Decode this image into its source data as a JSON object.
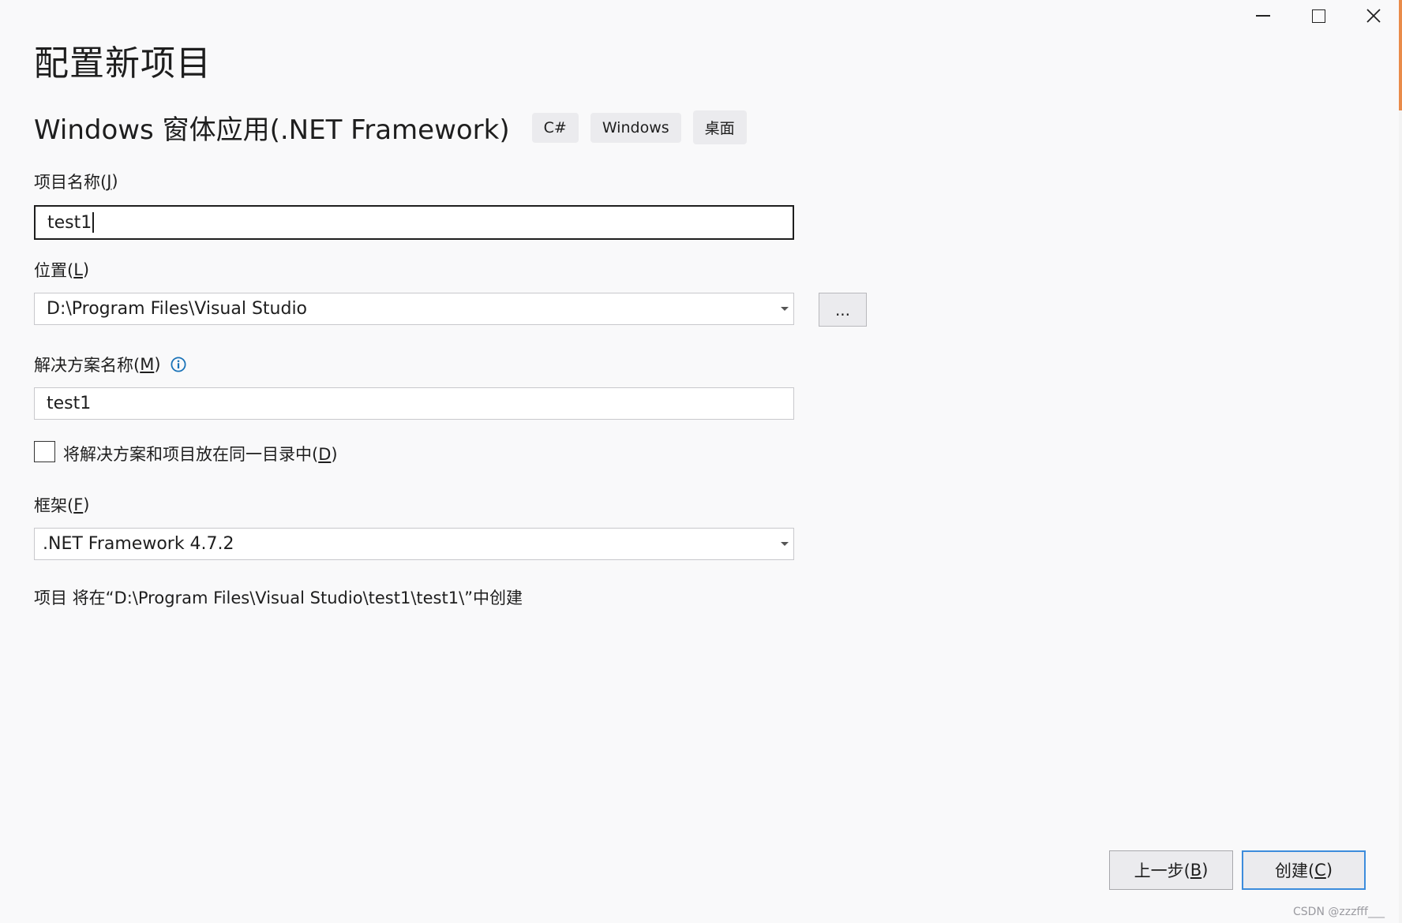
{
  "window": {
    "controls": [
      "minimize-icon",
      "maximize-icon",
      "close-icon"
    ]
  },
  "page_title": "配置新项目",
  "template": {
    "name": "Windows 窗体应用(.NET Framework)",
    "tags": [
      "C#",
      "Windows",
      "桌面"
    ]
  },
  "project_name": {
    "label_prefix": "项目名称(",
    "label_key": "J",
    "label_suffix": ")",
    "value": "test1"
  },
  "location": {
    "label_prefix": "位置(",
    "label_key": "L",
    "label_suffix": ")",
    "value": "D:\\Program Files\\Visual Studio",
    "browse_label": "..."
  },
  "solution_name": {
    "label_prefix": "解决方案名称(",
    "label_key": "M",
    "label_suffix": ")",
    "value": "test1",
    "info_icon": "info-icon"
  },
  "same_dir_checkbox": {
    "label_prefix": "将解决方案和项目放在同一目录中(",
    "label_key": "D",
    "label_suffix": ")",
    "checked": false
  },
  "framework": {
    "label_prefix": "框架(",
    "label_key": "F",
    "label_suffix": ")",
    "value": ".NET Framework 4.7.2"
  },
  "summary": "项目 将在“D:\\Program Files\\Visual Studio\\test1\\test1\\”中创建",
  "buttons": {
    "back_prefix": "上一步(",
    "back_key": "B",
    "back_suffix": ")",
    "create_prefix": "创建(",
    "create_key": "C",
    "create_suffix": ")"
  },
  "watermark": "CSDN @zzzfff___",
  "colors": {
    "accent": "#3c8cdc",
    "info": "#1a73b8",
    "background": "#f9f9fa"
  }
}
